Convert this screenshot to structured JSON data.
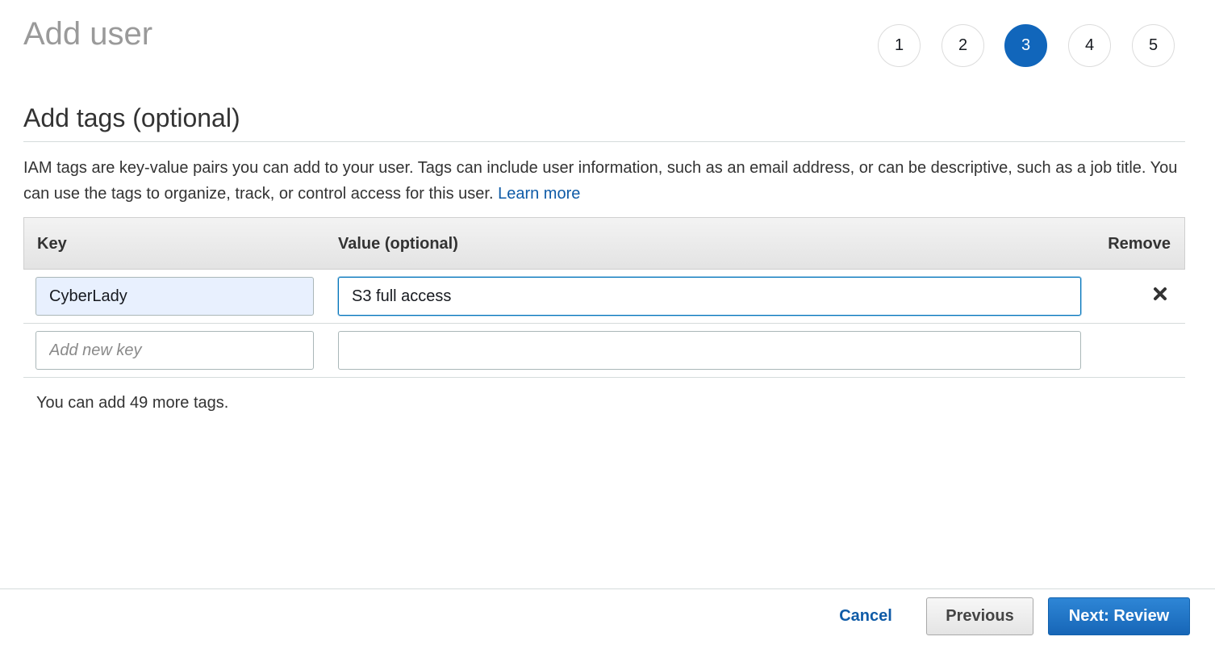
{
  "page": {
    "title": "Add user"
  },
  "steps": {
    "items": [
      "1",
      "2",
      "3",
      "4",
      "5"
    ],
    "active": "3",
    "active_color": "#1166bb"
  },
  "section": {
    "title": "Add tags (optional)",
    "description": "IAM tags are key-value pairs you can add to your user. Tags can include user information, such as an email address, or can be descriptive, such as a job title. You can use the tags to organize, track, or control access for this user.",
    "learn_more": "Learn more"
  },
  "table": {
    "headers": {
      "key": "Key",
      "value": "Value (optional)",
      "remove": "Remove"
    },
    "rows": [
      {
        "key": "CyberLady",
        "value": "S3 full access",
        "remove_icon": "close-icon"
      },
      {
        "key": "",
        "key_placeholder": "Add new key",
        "value": "",
        "value_placeholder": ""
      }
    ]
  },
  "tags_remaining": "You can add 49 more tags.",
  "footer": {
    "cancel": "Cancel",
    "previous": "Previous",
    "next": "Next: Review"
  },
  "colors": {
    "accent": "#1166bb",
    "link": "#0f5ba7",
    "primary_button": "#1766b7"
  }
}
